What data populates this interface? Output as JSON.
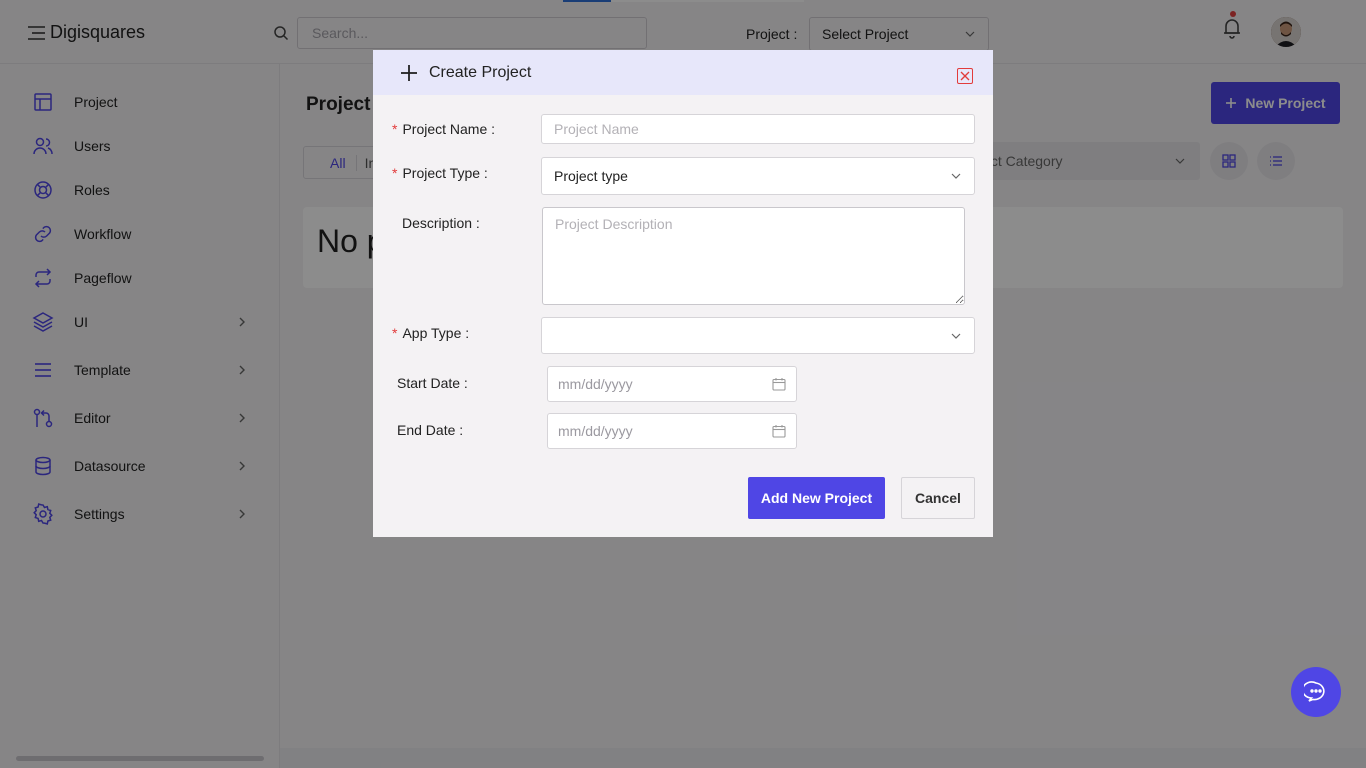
{
  "header": {
    "brand": "Digisquares",
    "search_placeholder": "Search...",
    "project_label": "Project :",
    "project_select_value": "Select Project"
  },
  "sidebar": {
    "items": [
      {
        "label": "Project",
        "icon": "table-icon",
        "has_submenu": false
      },
      {
        "label": "Users",
        "icon": "users-icon",
        "has_submenu": false
      },
      {
        "label": "Roles",
        "icon": "lifebuoy-icon",
        "has_submenu": false
      },
      {
        "label": "Workflow",
        "icon": "link-icon",
        "has_submenu": false
      },
      {
        "label": "Pageflow",
        "icon": "repeat-icon",
        "has_submenu": false
      },
      {
        "label": "UI",
        "icon": "layers-icon",
        "has_submenu": true
      },
      {
        "label": "Template",
        "icon": "menu-lines-icon",
        "has_submenu": true
      },
      {
        "label": "Editor",
        "icon": "git-pull-icon",
        "has_submenu": true
      },
      {
        "label": "Datasource",
        "icon": "database-icon",
        "has_submenu": true
      },
      {
        "label": "Settings",
        "icon": "gear-icon",
        "has_submenu": true
      }
    ]
  },
  "main": {
    "title": "Project",
    "new_project_label": "New Project",
    "tabs": [
      "All",
      "In"
    ],
    "category_placeholder": "ject Category",
    "empty_text": "No p"
  },
  "modal": {
    "title": "Create Project",
    "fields": {
      "project_name": {
        "label": "Project Name",
        "placeholder": "Project Name",
        "required": true
      },
      "project_type": {
        "label": "Project Type",
        "value": "Project type",
        "required": true
      },
      "description": {
        "label": "Description",
        "placeholder": "Project Description",
        "required": false
      },
      "app_type": {
        "label": "App Type",
        "value": "",
        "required": true
      },
      "start_date": {
        "label": "Start Date",
        "placeholder": "mm/dd/yyyy"
      },
      "end_date": {
        "label": "End Date",
        "placeholder": "mm/dd/yyyy"
      }
    },
    "submit_label": "Add New Project",
    "cancel_label": "Cancel"
  },
  "colors": {
    "accent": "#4f46e5",
    "required": "#e23b3b",
    "modal_header": "#e7e7fa",
    "notification_dot": "#e24040"
  }
}
